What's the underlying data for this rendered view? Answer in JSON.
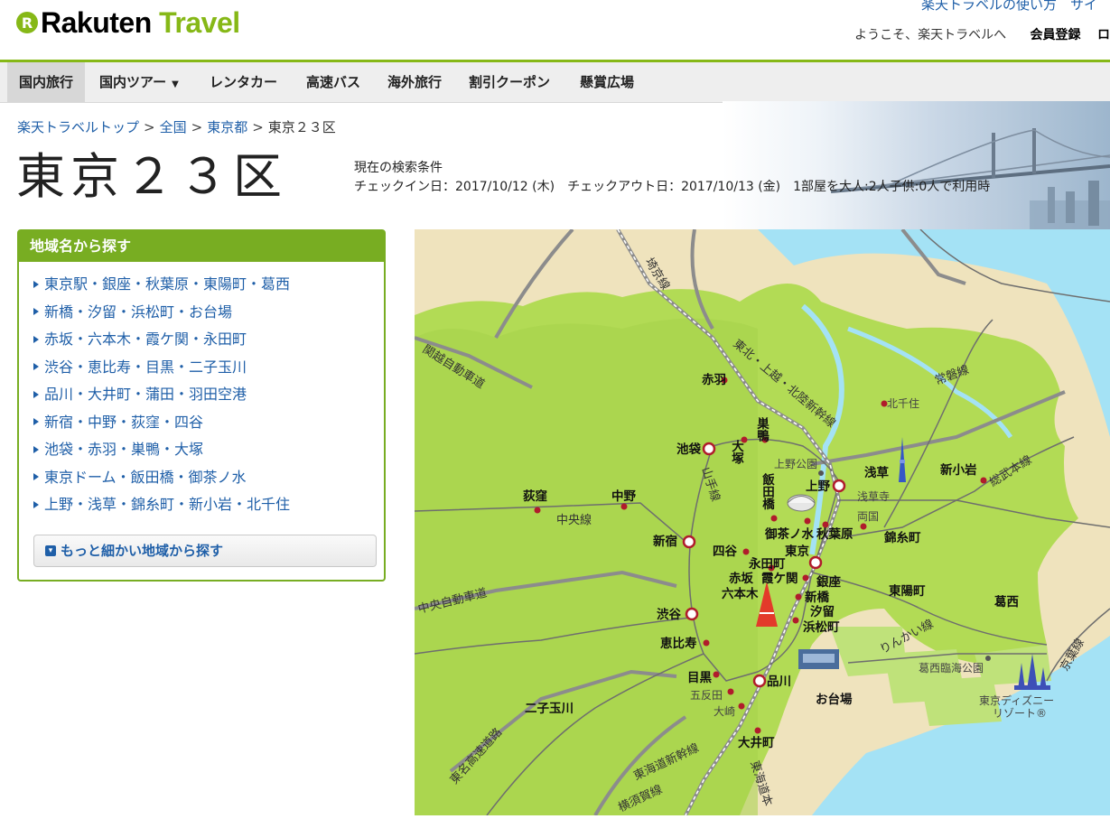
{
  "header": {
    "top_links": "楽天トラベルの使い方　サイ",
    "logo_rakuten": "Rakuten",
    "logo_travel": "Travel",
    "welcome": "ようこそ、楽天トラベルへ",
    "register": "会員登録",
    "login": "ロ"
  },
  "nav": {
    "items": [
      "国内旅行",
      "国内ツアー",
      "レンタカー",
      "高速バス",
      "海外旅行",
      "割引クーポン",
      "懸賞広場"
    ]
  },
  "breadcrumb": {
    "items": [
      "楽天トラベルトップ",
      "全国",
      "東京都"
    ],
    "current": "東京２３区",
    "separator": ">"
  },
  "page": {
    "title": "東京２３区",
    "condition_label": "現在の検索条件",
    "condition_text": "チェックイン日：2017/10/12 (木)　チェックアウト日：2017/10/13 (金)　1部屋を大人:2人子供:0人で利用時"
  },
  "sidebar": {
    "heading": "地域名から探す",
    "areas": [
      "東京駅・銀座・秋葉原・東陽町・葛西",
      "新橋・汐留・浜松町・お台場",
      "赤坂・六本木・霞ケ関・永田町",
      "渋谷・恵比寿・目黒・二子玉川",
      "品川・大井町・蒲田・羽田空港",
      "新宿・中野・荻窪・四谷",
      "池袋・赤羽・巣鴨・大塚",
      "東京ドーム・飯田橋・御茶ノ水",
      "上野・浅草・錦糸町・新小岩・北千住"
    ],
    "more_button": "もっと細かい地域から探す"
  },
  "map": {
    "colors": {
      "land": "#b2db55",
      "land_out": "#efe3bd",
      "water": "#a4e2f5",
      "road": "#8c8c8c",
      "station": "#b01c2c"
    },
    "major_stations": {
      "ikebukuro": "池袋",
      "ueno": "上野",
      "shinjuku": "新宿",
      "tokyo": "東京",
      "shibuya": "渋谷",
      "shinagawa": "品川"
    },
    "stations": {
      "akabane": "赤羽",
      "otsuka": "大塚",
      "sugamo": "巣鴨",
      "kitasenju": "北千住",
      "asakusa": "浅草",
      "shinkoiwa": "新小岩",
      "iidabashi": "飯田橋",
      "ogikubo": "荻窪",
      "nakano": "中野",
      "ochanomizu": "御茶ノ水",
      "akihabara": "秋葉原",
      "kinshicho": "錦糸町",
      "yotsuya": "四谷",
      "nagatacho": "永田町",
      "akasaka": "赤坂",
      "kasumigaseki": "霞ケ関",
      "roppongi": "六本木",
      "ginza": "銀座",
      "shinbashi": "新橋",
      "shiodome": "汐留",
      "hamamatsucho": "浜松町",
      "ebisu": "恵比寿",
      "meguro": "目黒",
      "gotanda": "五反田",
      "osaki": "大崎",
      "oimachi": "大井町",
      "futakotamagawa": "二子玉川"
    },
    "areas": {
      "toyocho": "東陽町",
      "kasai": "葛西",
      "odaiba": "お台場"
    },
    "landmarks": {
      "ueno_park": "上野公園",
      "sensoji": "浅草寺",
      "ryogoku": "両国",
      "kasai_park": "葛西臨海公園",
      "disney_1": "東京ディズニー",
      "disney_2": "リゾート®"
    },
    "lines": {
      "saikyo": "埼京線",
      "kanetsu": "関越自動車道",
      "tohoku": "東北・上越・北陸新幹線",
      "joban": "常磐線",
      "sobu": "総武本線",
      "yamanote": "山手線",
      "chuo": "中央線",
      "chuo_exp": "中央自動車道",
      "rinkai": "りんかい線",
      "keiyo": "京葉線",
      "tomei": "東名高速道路",
      "tokaido_shinkansen": "東海道新幹線",
      "yokosuka": "横須賀線",
      "tokaido_main": "東海道本"
    }
  }
}
